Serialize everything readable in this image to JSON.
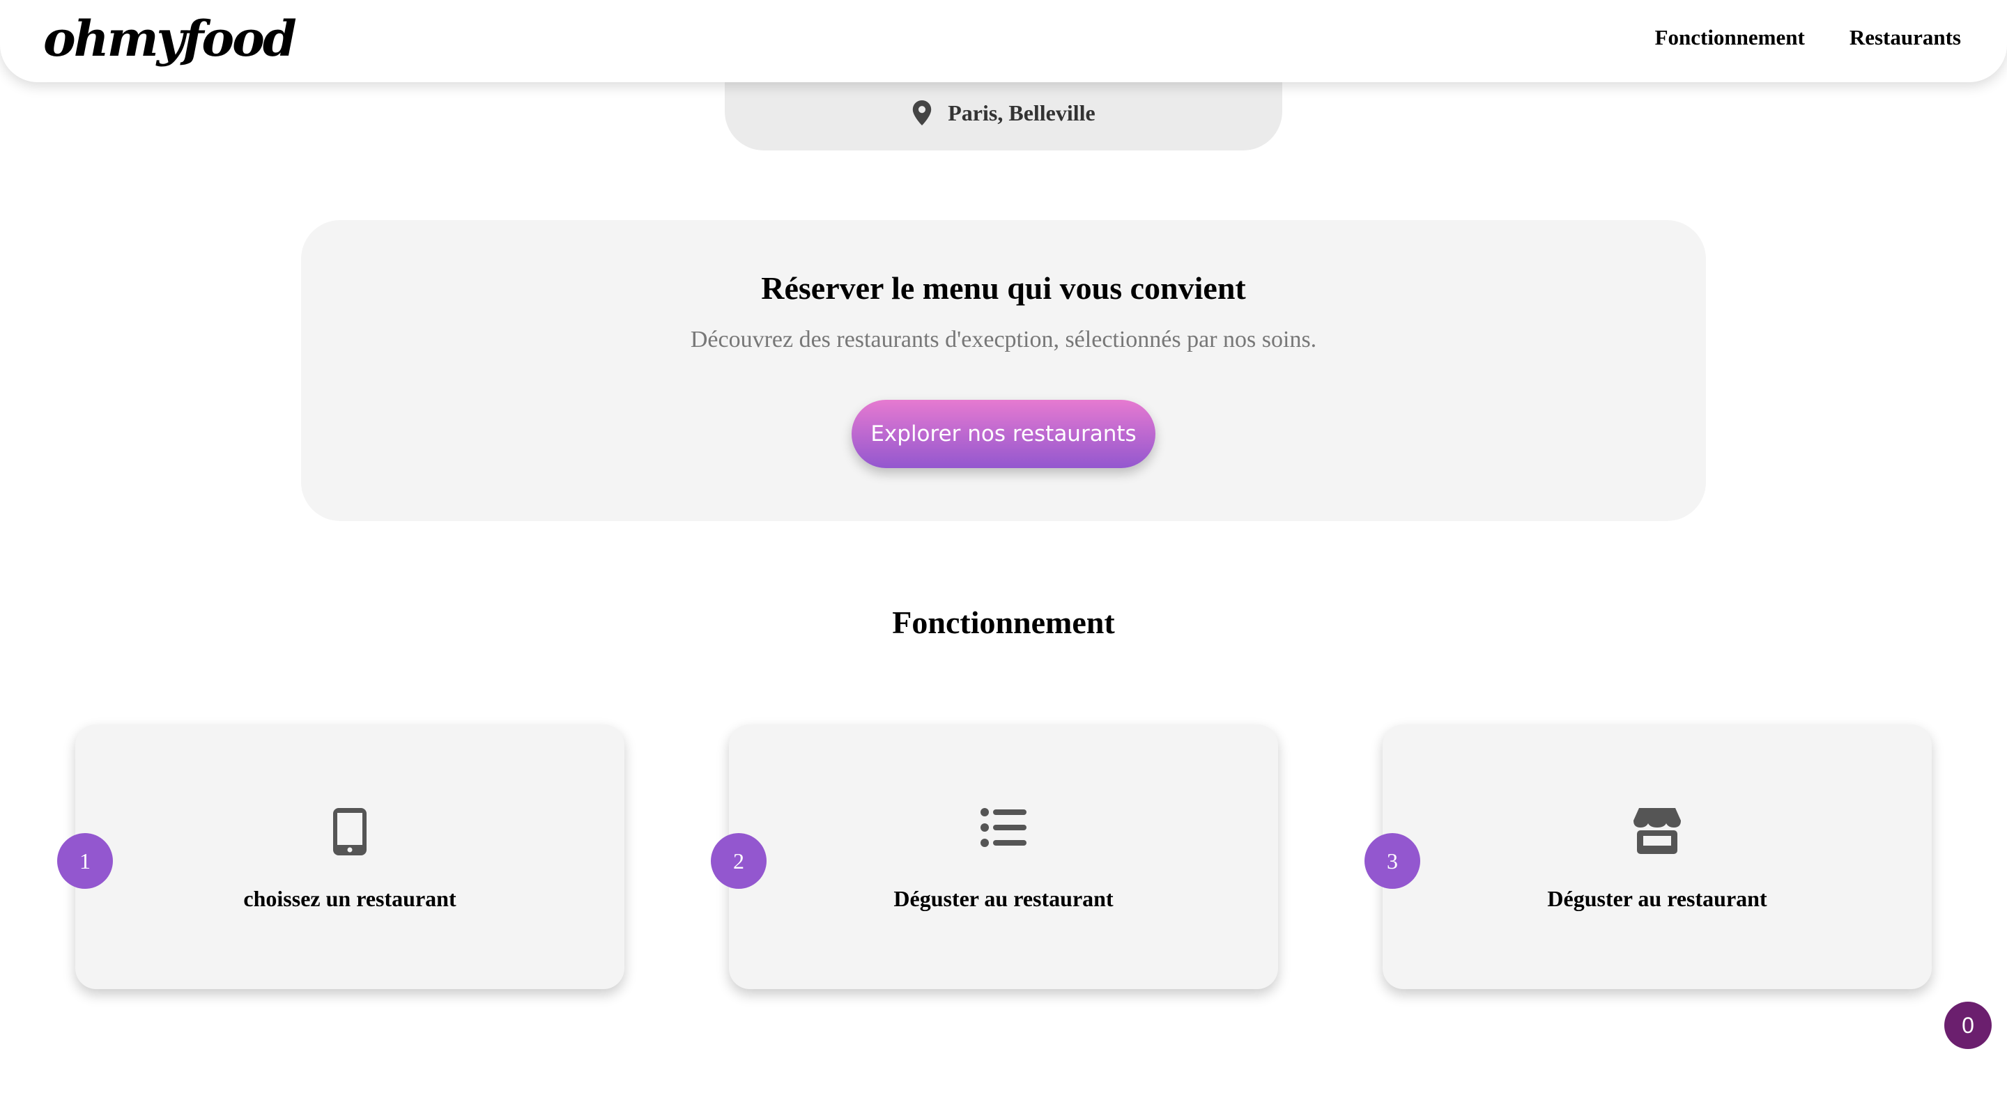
{
  "header": {
    "logo": "ohmyfood",
    "nav": [
      "Fonctionnement",
      "Restaurants"
    ]
  },
  "location": {
    "icon": "map-pin-icon",
    "text": "Paris, Belleville"
  },
  "reserve": {
    "title": "Réserver le menu qui vous convient",
    "subtitle": "Découvrez des restaurants d'execption, sélectionnés par nos soins.",
    "button_label": "Explorer nos restaurants"
  },
  "how_it_works": {
    "title": "Fonctionnement",
    "steps": [
      {
        "number": "1",
        "icon": "mobile-phone-icon",
        "label": "choissez un restaurant"
      },
      {
        "number": "2",
        "icon": "list-icon",
        "label": "Déguster au restaurant"
      },
      {
        "number": "3",
        "icon": "store-icon",
        "label": "Déguster au restaurant"
      }
    ]
  },
  "counter": {
    "value": "0"
  },
  "colors": {
    "accent": "#9357cf",
    "button_gradient_top": "#e67ad0",
    "button_gradient_bottom": "#9357cf",
    "counter_bg": "#6b1f6e",
    "card_bg": "#f4f4f4"
  }
}
